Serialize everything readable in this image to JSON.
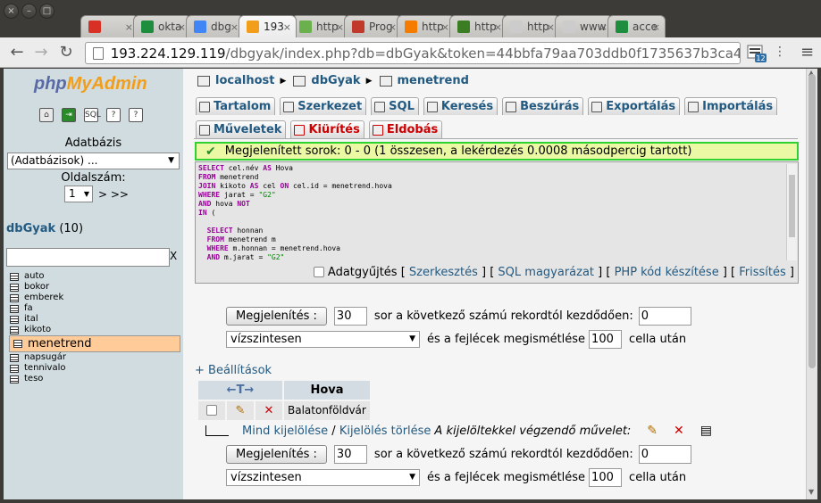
{
  "browser": {
    "window_buttons": [
      "×",
      "–",
      "□"
    ],
    "tabs": [
      {
        "title": "",
        "fav_color": "#d93025",
        "active": false
      },
      {
        "title": "okta",
        "fav_color": "#1e8e3e",
        "active": false
      },
      {
        "title": "dbg",
        "fav_color": "#4285f4",
        "active": false
      },
      {
        "title": "193",
        "fav_color": "#f29e1a",
        "active": true
      },
      {
        "title": "http",
        "fav_color": "#6ab04c",
        "active": false
      },
      {
        "title": "Prog",
        "fav_color": "#c0392b",
        "active": false
      },
      {
        "title": "http",
        "fav_color": "#f57c00",
        "active": false
      },
      {
        "title": "http",
        "fav_color": "#3a7d22",
        "active": false
      },
      {
        "title": "http",
        "fav_color": "#cccccc",
        "active": false
      },
      {
        "title": "www",
        "fav_color": "#cccccc",
        "active": false
      },
      {
        "title": "acce",
        "fav_color": "#1e8e3e",
        "active": false
      }
    ],
    "url_host": "193.224.129.119",
    "url_path": "/dbgyak/index.php?db=dbGyak&token=44bbfa79aa703ddb0f1735637b3ca444",
    "ext_badge": "12"
  },
  "nav": {
    "logo": {
      "php": "php",
      "my": "My",
      "admin": "Admin"
    },
    "db_label": "Adatbázis",
    "db_select": "(Adatbázisok) ...",
    "page_label": "Oldalszám:",
    "page_value": "1",
    "page_nav": "> >>",
    "db_name": "dbGyak",
    "db_count": "(10)",
    "filter_clear": "X",
    "tables": [
      "auto",
      "bokor",
      "emberek",
      "fa",
      "ital",
      "kikoto",
      "menetrend",
      "napsugár",
      "tennivalo",
      "teso"
    ],
    "selected_table": "menetrend"
  },
  "breadcrumb": {
    "server": "localhost",
    "db": "dbGyak",
    "table": "menetrend"
  },
  "tabs_row1": [
    "Tartalom",
    "Szerkezet",
    "SQL",
    "Keresés",
    "Beszúrás",
    "Exportálás",
    "Importálás"
  ],
  "tabs_row2": [
    "Műveletek",
    "Kiürítés",
    "Eldobás"
  ],
  "message": "Megjelenített sorok: 0 - 0 (1 összesen, a lekérdezés 0.0008 másodpercig tartott)",
  "sql_links": {
    "profiling": "Adatgyűjtés",
    "edit": "Szerkesztés",
    "explain": "SQL magyarázat",
    "php": "PHP kód készítése",
    "refresh": "Frissítés"
  },
  "nav_form": {
    "show_button": "Megjelenítés :",
    "rows": "30",
    "rows_text": "sor a következő számú rekordtól kezdődően:",
    "start": "0",
    "mode": "vízszintesen",
    "repeat_text": "és a fejlécek megismétlése",
    "repeat": "100",
    "cells_text": "cella után"
  },
  "settings_link": "+ Beállítások",
  "result": {
    "column": "Hova",
    "rows": [
      "Balatonföldvár"
    ]
  },
  "bulk": {
    "check_all": "Mind kijelölése",
    "uncheck_all": "Kijelölés törlése",
    "with_selected": "A kijelöltekkel végzendő művelet:"
  }
}
